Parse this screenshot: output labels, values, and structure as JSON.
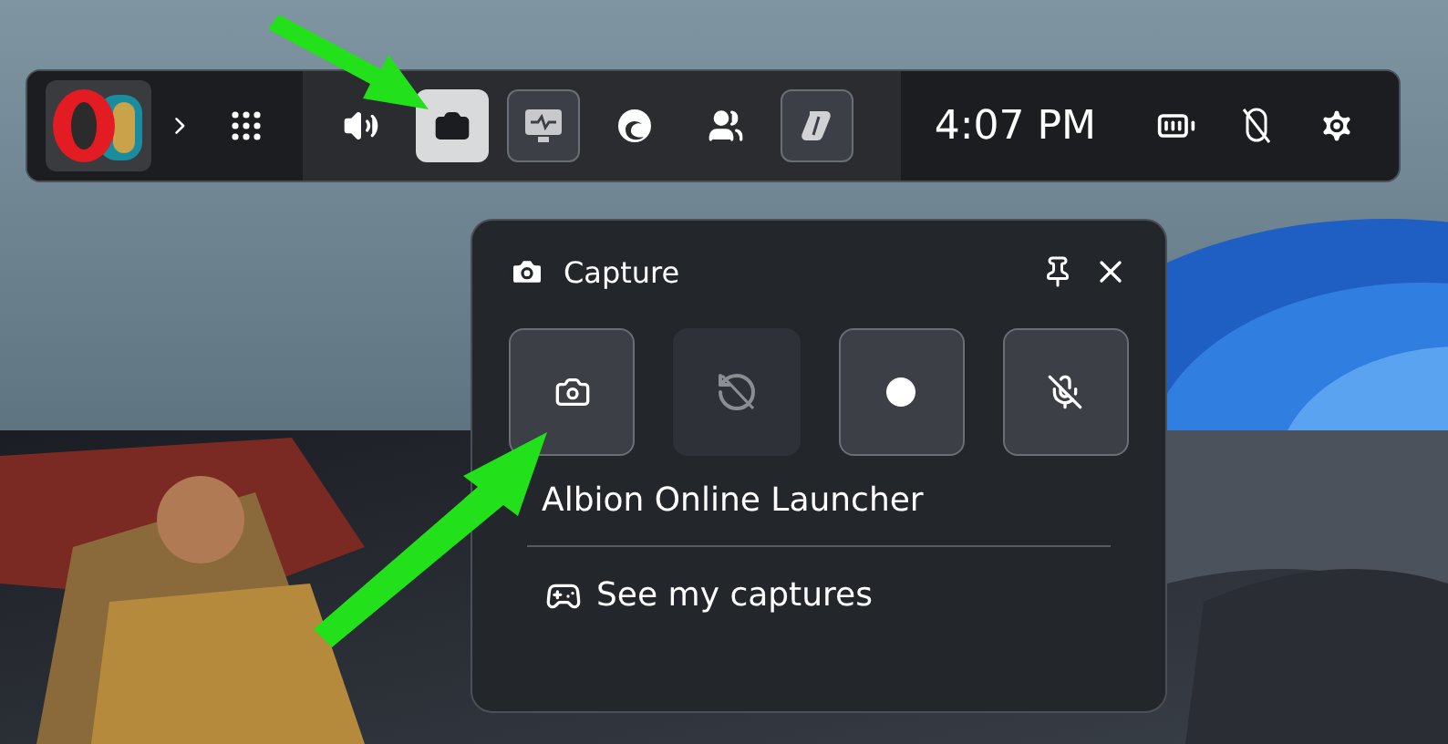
{
  "game_bar": {
    "app_tile": {
      "selected": true
    },
    "widgets": [
      {
        "kind": "audio",
        "selected": false,
        "open": false
      },
      {
        "kind": "capture",
        "selected": true,
        "open": true
      },
      {
        "kind": "performance",
        "selected": false,
        "open": true
      },
      {
        "kind": "browser",
        "selected": false,
        "open": false
      },
      {
        "kind": "social",
        "selected": false,
        "open": false
      },
      {
        "kind": "assistant",
        "selected": false,
        "open": true
      }
    ],
    "time": "4:07 PM"
  },
  "capture_panel": {
    "title": "Capture",
    "buttons": [
      {
        "kind": "screenshot",
        "disabled": false
      },
      {
        "kind": "record_last",
        "disabled": true
      },
      {
        "kind": "record",
        "disabled": false
      },
      {
        "kind": "microphone",
        "disabled": false
      }
    ],
    "app_name": "Albion Online Launcher",
    "link": "See my captures"
  }
}
